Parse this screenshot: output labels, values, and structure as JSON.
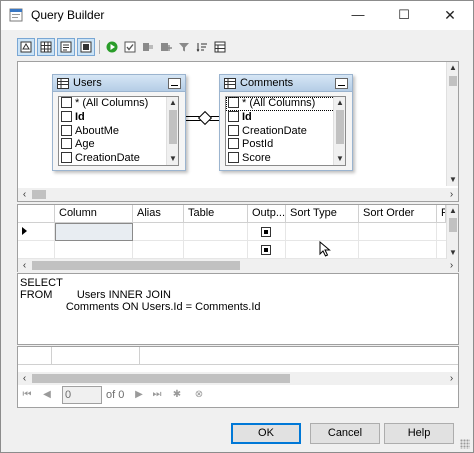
{
  "window": {
    "title": "Query Builder",
    "minimize": "—",
    "maximize": "☐",
    "close": "✕"
  },
  "diagram": {
    "tables": [
      {
        "name": "Users",
        "columns": [
          "* (All Columns)",
          "Id",
          "AboutMe",
          "Age",
          "CreationDate"
        ],
        "bold": [
          1
        ],
        "checked": []
      },
      {
        "name": "Comments",
        "columns": [
          "* (All Columns)",
          "Id",
          "CreationDate",
          "PostId",
          "Score"
        ],
        "bold": [
          1
        ],
        "checked": []
      }
    ]
  },
  "grid": {
    "headers": [
      "Column",
      "Alias",
      "Table",
      "Outp...",
      "Sort Type",
      "Sort Order",
      "F"
    ],
    "rows": [
      {
        "output": true
      },
      {
        "output": true
      }
    ]
  },
  "sql": {
    "lines": [
      "SELECT",
      "FROM        Users INNER JOIN",
      "               Comments ON Users.Id = Comments.Id"
    ]
  },
  "navigator": {
    "position": "0",
    "of_label": "of 0"
  },
  "buttons": {
    "ok": "OK",
    "cancel": "Cancel",
    "help": "Help"
  },
  "colors": {
    "accent": "#0078d7",
    "table_header": "#c9dbee",
    "selected_toolbar": "#cce4f7"
  }
}
